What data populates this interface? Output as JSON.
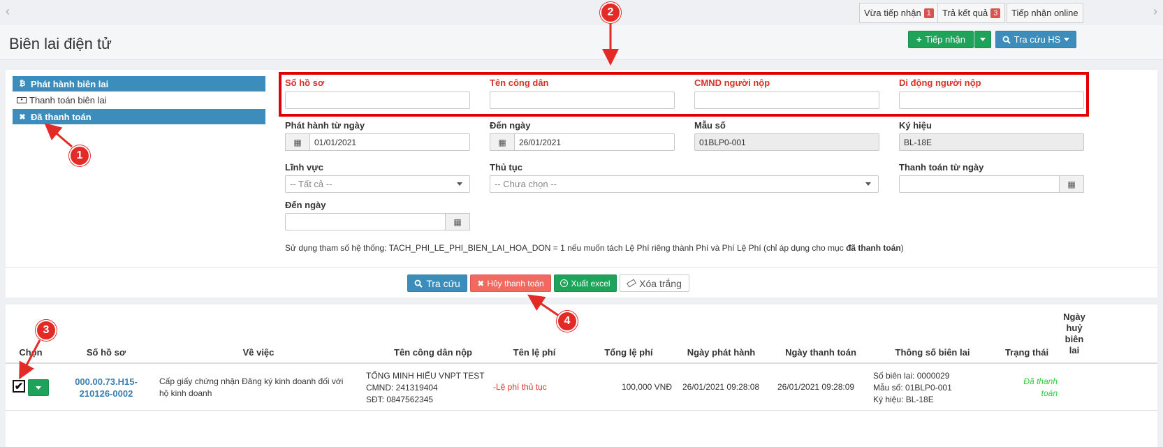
{
  "top": {
    "btn_vua_tiep_nhan": "Vừa tiếp nhận",
    "badge_vua": "1",
    "btn_tra_ket_qua": "Trả kết quả",
    "badge_tra": "3",
    "btn_tiep_nhan_online": "Tiếp nhận online"
  },
  "header": {
    "title": "Biên lai điện tử",
    "btn_tiep_nhan": "Tiếp nhận",
    "btn_tra_cuu_hs": "Tra cứu HS"
  },
  "sidebar": {
    "items": [
      {
        "label": "Phát hành biên lai",
        "icon": "bitcoin-icon"
      },
      {
        "label": "Thanh toán biên lai",
        "icon": "money-icon"
      },
      {
        "label": "Đã thanh toán",
        "icon": "close-icon"
      }
    ]
  },
  "form": {
    "so_ho_so_label": "Số hồ sơ",
    "ten_cong_dan_label": "Tên công dân",
    "cmnd_label": "CMND người nộp",
    "di_dong_label": "Di động người nộp",
    "phat_hanh_tu_ngay_label": "Phát hành từ ngày",
    "phat_hanh_tu_ngay_value": "01/01/2021",
    "den_ngay_label": "Đến ngày",
    "den_ngay_value": "26/01/2021",
    "mau_so_label": "Mẫu số",
    "mau_so_value": "01BLP0-001",
    "ky_hieu_label": "Ký hiệu",
    "ky_hieu_value": "BL-18E",
    "linh_vuc_label": "Lĩnh vực",
    "linh_vuc_value": "-- Tất cả --",
    "thu_tuc_label": "Thủ tục",
    "thu_tuc_value": "-- Chưa chọn --",
    "thanh_toan_tu_ngay_label": "Thanh toán từ ngày",
    "den_ngay2_label": "Đến ngày",
    "note_prefix": "Sử dụng tham số hệ thống: TACH_PHI_LE_PHI_BIEN_LAI_HOA_DON = 1 nếu muốn tách Lệ Phí riêng thành Phí và Phí Lệ Phí (chỉ áp dụng cho mục ",
    "note_bold": "đã thanh toán",
    "note_suffix": ")"
  },
  "actions": {
    "tra_cuu": "Tra cứu",
    "huy_thanh_toan": "Hủy thanh toán",
    "xuat_excel": "Xuất excel",
    "xoa_trang": "Xóa trắng"
  },
  "table": {
    "headers": {
      "chon": "Chọn",
      "so_ho_so": "Số hồ sơ",
      "ve_viec": "Về việc",
      "ten_cong_dan_nop": "Tên công dân nộp",
      "ten_le_phi": "Tên lệ phí",
      "tong_le_phi": "Tổng lệ phí",
      "ngay_phat_hanh": "Ngày phát hành",
      "ngay_thanh_toan": "Ngày thanh toán",
      "thong_so_bien_lai": "Thông số biên lai",
      "trang_thai": "Trạng thái",
      "ngay_huy_1": "Ngày",
      "ngay_huy_2": "huỷ",
      "ngay_huy_3": "biên",
      "ngay_huy_4": "lai"
    },
    "row": {
      "so_ho_so_1": "000.00.73.H15-",
      "so_ho_so_2": "210126-0002",
      "ve_viec_1": "Cấp giấy chứng nhận Đăng ký kinh doanh đối với",
      "ve_viec_2": "hộ kinh doanh",
      "cong_dan_ten": "TỔNG MINH HIẾU VNPT TEST",
      "cong_dan_cmnd": "CMND: 241319404",
      "cong_dan_sdt": "SĐT: 0847562345",
      "ten_le_phi": "-Lệ phí thủ tục",
      "tong_le_phi": "100,000 VNĐ",
      "ngay_phat_hanh": "26/01/2021 09:28:08",
      "ngay_thanh_toan": "26/01/2021 09:28:09",
      "so_bien_lai": "Số biên lai: 0000029",
      "mau_so": "Mẫu số: 01BLP0-001",
      "ky_hieu": "Ký hiệu: BL-18E",
      "trang_thai_1": "Đã thanh",
      "trang_thai_2": "toán"
    }
  },
  "markers": [
    "1",
    "2",
    "3",
    "4"
  ],
  "colors": {
    "primary": "#3c8dbc",
    "success": "#1fa35a",
    "danger": "#f2695f",
    "annotation": "#e32a27"
  }
}
